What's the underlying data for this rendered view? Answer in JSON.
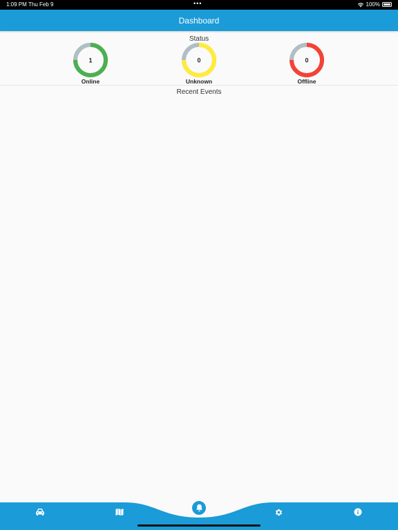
{
  "status_bar": {
    "time": "1:09 PM",
    "date": "Thu Feb 9",
    "dots": "•••",
    "battery": "100%"
  },
  "header": {
    "title": "Dashboard"
  },
  "status_section": {
    "title": "Status",
    "gauges": [
      {
        "label": "Online",
        "count": "1",
        "fraction": 0.75,
        "color": "#4caf50"
      },
      {
        "label": "Unknown",
        "count": "0",
        "fraction": 0.75,
        "color": "#ffeb3b"
      },
      {
        "label": "Offline",
        "count": "0",
        "fraction": 0.75,
        "color": "#f44336"
      }
    ],
    "track_color": "#b0bec5"
  },
  "events_section": {
    "title": "Recent Events"
  },
  "bottom_nav": {
    "color": "#1b9bd7",
    "items": [
      {
        "icon": "car-icon"
      },
      {
        "icon": "map-icon"
      },
      {
        "icon": "bell-icon",
        "active": true
      },
      {
        "icon": "gear-icon"
      },
      {
        "icon": "info-icon"
      }
    ]
  }
}
